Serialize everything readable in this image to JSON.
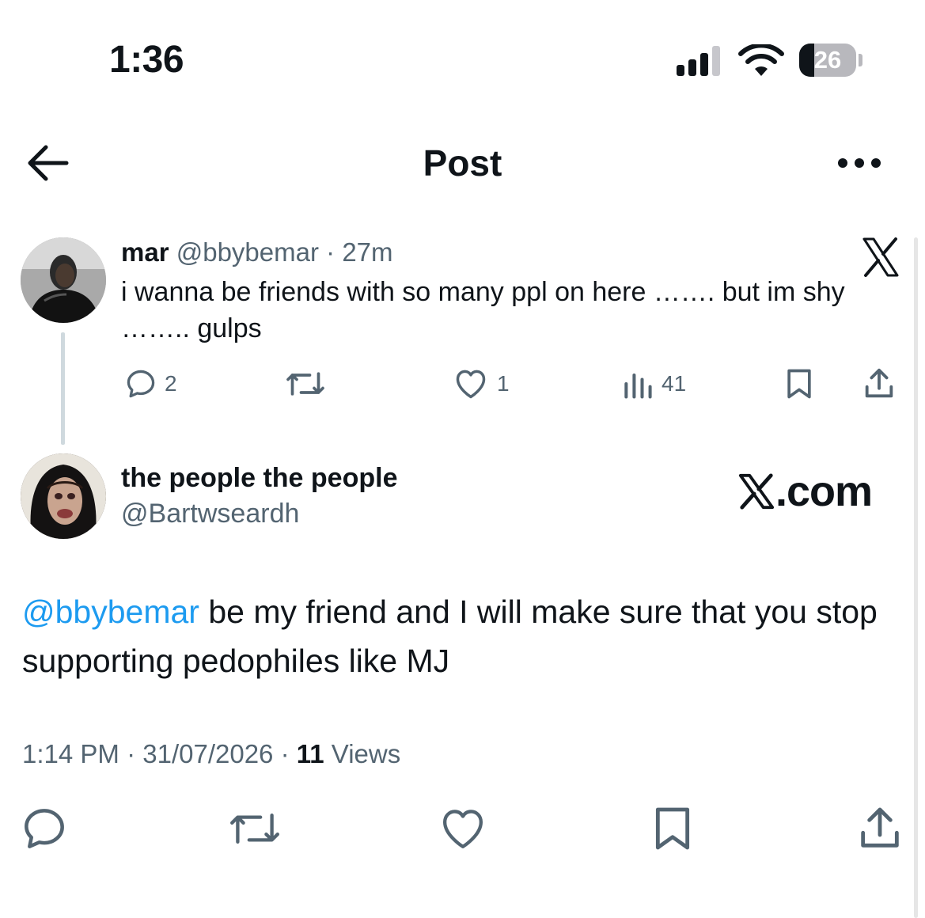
{
  "status_bar": {
    "time": "1:36",
    "battery_percent": "26",
    "battery_level": 0.26
  },
  "header": {
    "title": "Post",
    "back_icon": "arrow-left-icon",
    "more_icon": "more-horizontal-icon"
  },
  "parent_tweet": {
    "name": "mar",
    "handle": "@bbybemar",
    "separator": "·",
    "time": "27m",
    "text": "i wanna be friends with so many ppl on here ……. but im shy …….. gulps",
    "actions": {
      "reply_count": "2",
      "retweet_count": "",
      "like_count": "1",
      "views_count": "41"
    }
  },
  "main_tweet": {
    "name": "the people the people",
    "handle": "@Bartwseardh",
    "mention": "@bbybemar",
    "text": " be my friend and I will make sure that you stop supporting pedophiles like MJ",
    "time": "1:14 PM",
    "sep1": " · ",
    "date": "31/07/2026",
    "sep2": " · ",
    "views_count": "11",
    "views_label": " Views"
  },
  "watermark": {
    "text": ".com"
  },
  "colors": {
    "text_primary": "#0f1419",
    "text_secondary": "#536471",
    "link": "#1d9bf0",
    "thread_line": "#cfd9de"
  }
}
